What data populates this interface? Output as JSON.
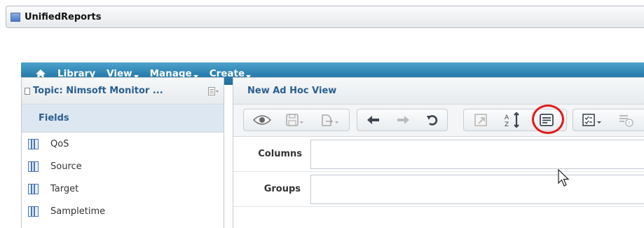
{
  "window": {
    "title": "UnifiedReports"
  },
  "nav": {
    "items": [
      {
        "label": "Library",
        "has_menu": false
      },
      {
        "label": "View",
        "has_menu": true
      },
      {
        "label": "Manage",
        "has_menu": true
      },
      {
        "label": "Create",
        "has_menu": true
      }
    ]
  },
  "left_panel": {
    "topic_label": "Topic: Nimsoft Monitor ...",
    "fields_header": "Fields",
    "fields": [
      "QoS",
      "Source",
      "Target",
      "Sampletime"
    ]
  },
  "main_panel": {
    "title": "New Ad Hoc View",
    "columns_label": "Columns",
    "groups_label": "Groups"
  },
  "colors": {
    "nav_bar": "#2b7fae",
    "header_text": "#2a5f8f",
    "highlight_circle": "#e21b1b"
  },
  "icons": {
    "toolbar": [
      "eye-icon",
      "save-icon",
      "export-icon",
      "undo-icon",
      "redo-icon",
      "undo-all-icon",
      "switch-group-icon",
      "sort-icon",
      "query-icon",
      "options-icon",
      "filter-icon"
    ]
  }
}
